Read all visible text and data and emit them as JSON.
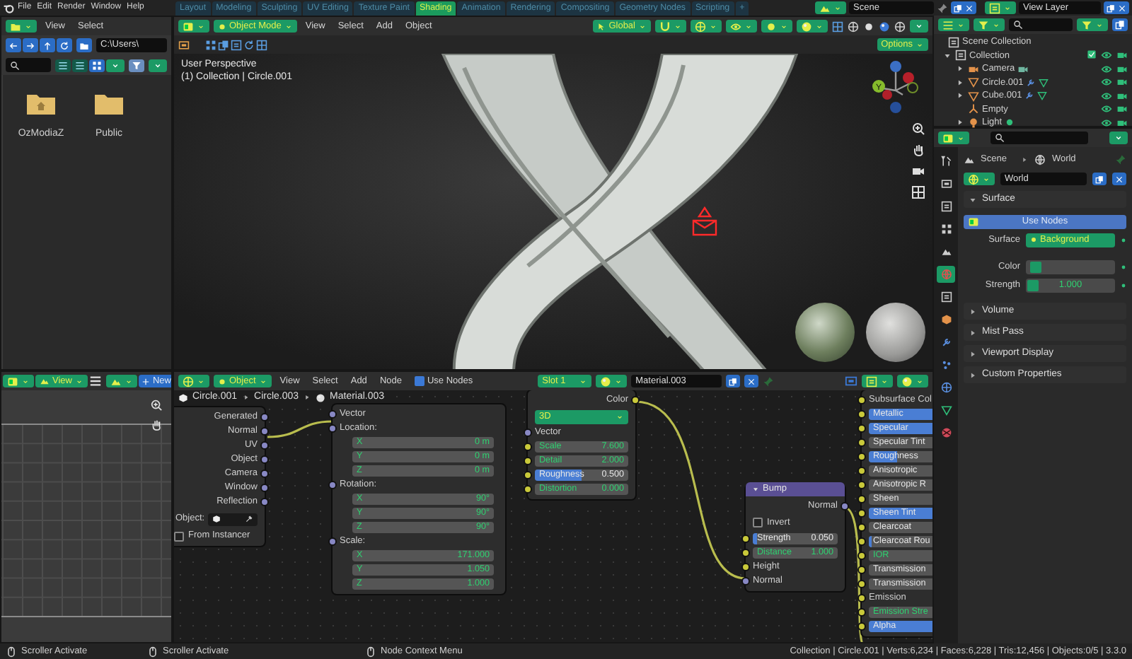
{
  "top_bar": {
    "menus": [
      "File",
      "Edit",
      "Render",
      "Window",
      "Help"
    ],
    "workspaces": [
      {
        "label": "Layout",
        "selected": false
      },
      {
        "label": "Modeling",
        "selected": false
      },
      {
        "label": "Sculpting",
        "selected": false
      },
      {
        "label": "UV Editing",
        "selected": false
      },
      {
        "label": "Texture Paint",
        "selected": false
      },
      {
        "label": "Shading",
        "selected": true
      },
      {
        "label": "Animation",
        "selected": false
      },
      {
        "label": "Rendering",
        "selected": false
      },
      {
        "label": "Compositing",
        "selected": false
      },
      {
        "label": "Geometry Nodes",
        "selected": false
      },
      {
        "label": "Scripting",
        "selected": false
      }
    ],
    "add_tab": "+",
    "scene": "Scene",
    "view_layer": "View Layer"
  },
  "file_browser": {
    "menus": [
      "View",
      "Select"
    ],
    "path": "C:\\Users\\",
    "folders": [
      {
        "name": "OzModiaZ",
        "kind": "home"
      },
      {
        "name": "Public",
        "kind": "plain"
      }
    ]
  },
  "viewport": {
    "mode": "Object Mode",
    "menus": [
      "View",
      "Select",
      "Add",
      "Object"
    ],
    "orientation": "Global",
    "options": "Options",
    "info": [
      "User Perspective",
      "(1) Collection | Circle.001"
    ],
    "gizmo_label": "Y"
  },
  "outliner": {
    "root": "Scene Collection",
    "items": [
      {
        "name": "Collection",
        "kind": "collection",
        "expanded": true,
        "checked": true,
        "children": [
          {
            "name": "Camera",
            "kind": "camera",
            "expanded": false
          },
          {
            "name": "Circle.001",
            "kind": "mesh",
            "expanded": false
          },
          {
            "name": "Cube.001",
            "kind": "mesh",
            "expanded": false
          },
          {
            "name": "Empty",
            "kind": "empty"
          },
          {
            "name": "Light",
            "kind": "light",
            "expanded": false
          }
        ]
      }
    ]
  },
  "properties": {
    "tabs": [
      {
        "kind": "tool",
        "selected": false
      },
      {
        "kind": "render",
        "selected": false
      },
      {
        "kind": "output",
        "selected": false
      },
      {
        "kind": "view_layer",
        "selected": false
      },
      {
        "kind": "scene",
        "selected": false
      },
      {
        "kind": "world",
        "selected": true
      },
      {
        "kind": "collection",
        "selected": false
      },
      {
        "kind": "object",
        "selected": false
      },
      {
        "kind": "modifiers",
        "selected": false
      },
      {
        "kind": "particles",
        "selected": false
      },
      {
        "kind": "physics",
        "selected": false
      },
      {
        "kind": "data",
        "selected": false
      },
      {
        "kind": "material",
        "selected": false
      }
    ],
    "breadcrumbs": [
      "Scene",
      "World"
    ],
    "world": "World",
    "panels": [
      {
        "title": "Surface",
        "expanded": true
      },
      {
        "title": "Volume",
        "expanded": false
      },
      {
        "title": "Mist Pass",
        "expanded": false
      },
      {
        "title": "Viewport Display",
        "expanded": false
      },
      {
        "title": "Custom Properties",
        "expanded": false
      }
    ],
    "use_nodes": "Use Nodes",
    "fields": [
      {
        "label": "Surface",
        "value": "Background",
        "kind": "shader"
      },
      {
        "label": "Color",
        "kind": "color"
      },
      {
        "label": "Strength",
        "value": "1.000",
        "kind": "number"
      }
    ]
  },
  "image_editor": {
    "menus": [
      "View"
    ],
    "new": "New"
  },
  "node_editor": {
    "object_type": "Object",
    "menus": [
      "View",
      "Select",
      "Add",
      "Node"
    ],
    "use_nodes": {
      "label": "Use Nodes",
      "checked": true
    },
    "slot": "Slot 1",
    "material": "Material.003",
    "breadcrumbs": [
      "Circle.001",
      "Circle.003",
      "Material.003"
    ],
    "nodes": [
      {
        "kind": "texcoord",
        "outputs": [
          "Generated",
          "Normal",
          "UV",
          "Object",
          "Camera",
          "Window",
          "Reflection"
        ],
        "object_label": "Object:",
        "from_instancer": {
          "label": "From Instancer",
          "checked": false
        }
      },
      {
        "kind": "mapping",
        "input": "Vector",
        "groups": [
          {
            "title": "Location:",
            "fields": [
              {
                "axis": "X",
                "value": "0 m"
              },
              {
                "axis": "Y",
                "value": "0 m"
              },
              {
                "axis": "Z",
                "value": "0 m"
              }
            ]
          },
          {
            "title": "Rotation:",
            "fields": [
              {
                "axis": "X",
                "value": "90°"
              },
              {
                "axis": "Y",
                "value": "90°"
              },
              {
                "axis": "Z",
                "value": "90°"
              }
            ]
          },
          {
            "title": "Scale:",
            "fields": [
              {
                "axis": "X",
                "value": "171.000"
              },
              {
                "axis": "Y",
                "value": "1.050"
              },
              {
                "axis": "Z",
                "value": "1.000"
              }
            ]
          }
        ]
      },
      {
        "kind": "noise",
        "output": "Color",
        "dimensions": "3D",
        "input": "Vector",
        "fields": [
          {
            "label": "Scale",
            "value": "7.600",
            "kind": "number"
          },
          {
            "label": "Detail",
            "value": "2.000",
            "kind": "number"
          },
          {
            "label": "Roughness",
            "value": "0.500",
            "kind": "factor",
            "level": 0.5
          },
          {
            "label": "Distortion",
            "value": "0.000",
            "kind": "number"
          }
        ]
      },
      {
        "kind": "bump",
        "title": "Bump",
        "output": "Normal",
        "invert": {
          "label": "Invert",
          "checked": false
        },
        "fields": [
          {
            "label": "Strength",
            "value": "0.050",
            "kind": "factor",
            "level": 0.05
          },
          {
            "label": "Distance",
            "value": "1.000",
            "kind": "number"
          }
        ],
        "inputs": [
          "Height",
          "Normal"
        ]
      },
      {
        "kind": "bsdf",
        "rows": [
          {
            "label": "Subsurface Col",
            "kind": "socket"
          },
          {
            "label": "Metallic",
            "kind": "factor",
            "level": 1
          },
          {
            "label": "Specular",
            "kind": "factor",
            "level": 1
          },
          {
            "label": "Specular Tint",
            "kind": "factor"
          },
          {
            "label": "Roughness",
            "kind": "factor",
            "level": 0.4
          },
          {
            "label": "Anisotropic",
            "kind": "factor"
          },
          {
            "label": "Anisotropic R",
            "kind": "factor"
          },
          {
            "label": "Sheen",
            "kind": "factor"
          },
          {
            "label": "Sheen Tint",
            "kind": "factor",
            "level": 1
          },
          {
            "label": "Clearcoat",
            "kind": "factor"
          },
          {
            "label": "Clearcoat Rou",
            "kind": "factor",
            "level": 0.05
          },
          {
            "label": "IOR",
            "kind": "number"
          },
          {
            "label": "Transmission",
            "kind": "factor"
          },
          {
            "label": "Transmission",
            "kind": "factor"
          },
          {
            "label": "Emission",
            "kind": "socket"
          },
          {
            "label": "Emission Stre",
            "kind": "number"
          },
          {
            "label": "Alpha",
            "kind": "factor",
            "level": 1
          }
        ]
      }
    ]
  },
  "status_bar": {
    "hints": [
      "Scroller Activate",
      "Scroller Activate",
      "Node Context Menu"
    ],
    "stats": "Collection | Circle.001 | Verts:6,234 | Faces:6,228 | Tris:12,456 | Objects:0/5 | 3.3.0"
  }
}
